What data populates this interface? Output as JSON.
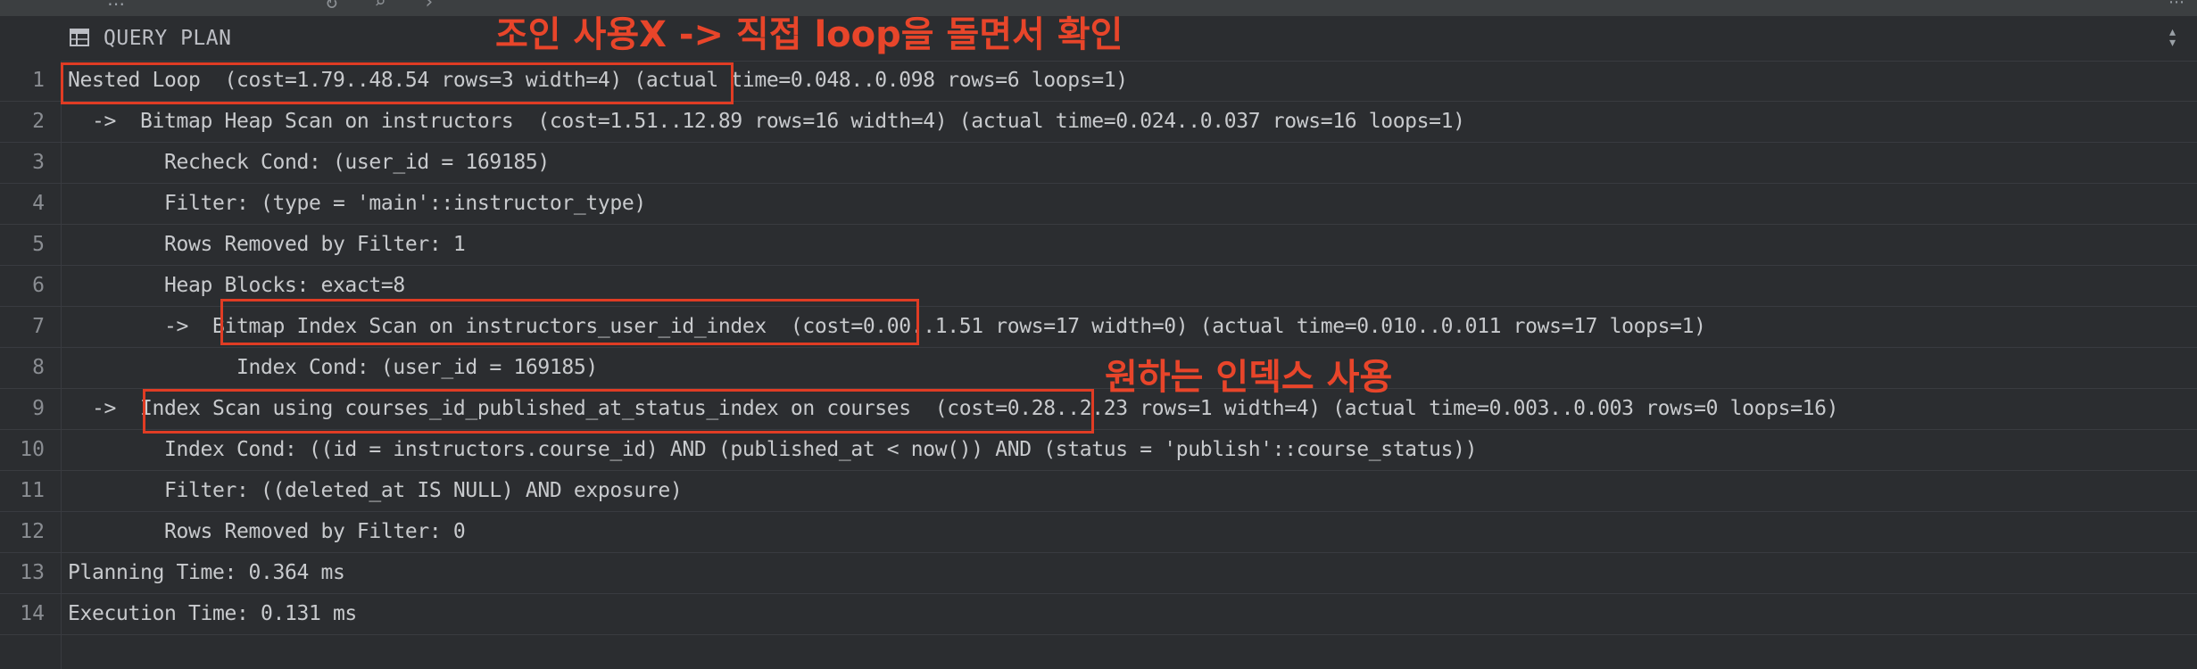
{
  "header": {
    "column_title": "QUERY PLAN",
    "table_icon": "table-grid-icon",
    "sort_icon": "sort-updown-icon"
  },
  "rows": [
    {
      "num": "1",
      "text": "Nested Loop  (cost=1.79..48.54 rows=3 width=4) (actual time=0.048..0.098 rows=6 loops=1)"
    },
    {
      "num": "2",
      "text": "  ->  Bitmap Heap Scan on instructors  (cost=1.51..12.89 rows=16 width=4) (actual time=0.024..0.037 rows=16 loops=1)"
    },
    {
      "num": "3",
      "text": "        Recheck Cond: (user_id = 169185)"
    },
    {
      "num": "4",
      "text": "        Filter: (type = 'main'::instructor_type)"
    },
    {
      "num": "5",
      "text": "        Rows Removed by Filter: 1"
    },
    {
      "num": "6",
      "text": "        Heap Blocks: exact=8"
    },
    {
      "num": "7",
      "text": "        ->  Bitmap Index Scan on instructors_user_id_index  (cost=0.00..1.51 rows=17 width=0) (actual time=0.010..0.011 rows=17 loops=1)"
    },
    {
      "num": "8",
      "text": "              Index Cond: (user_id = 169185)"
    },
    {
      "num": "9",
      "text": "  ->  Index Scan using courses_id_published_at_status_index on courses  (cost=0.28..2.23 rows=1 width=4) (actual time=0.003..0.003 rows=0 loops=16)"
    },
    {
      "num": "10",
      "text": "        Index Cond: ((id = instructors.course_id) AND (published_at < now()) AND (status = 'publish'::course_status))"
    },
    {
      "num": "11",
      "text": "        Filter: ((deleted_at IS NULL) AND exposure)"
    },
    {
      "num": "12",
      "text": "        Rows Removed by Filter: 0"
    },
    {
      "num": "13",
      "text": "Planning Time: 0.364 ms"
    },
    {
      "num": "14",
      "text": "Execution Time: 0.131 ms"
    }
  ],
  "annotations": {
    "join_note": "조인 사용X -> 직접 loop을 돌면서 확인",
    "index_note": "원하는 인덱스 사용",
    "color": "#e8452a"
  },
  "colors": {
    "background": "#2b2d30",
    "text": "#c8cacd",
    "line_number": "#8a8d92",
    "highlight_box": "#e03c24"
  }
}
